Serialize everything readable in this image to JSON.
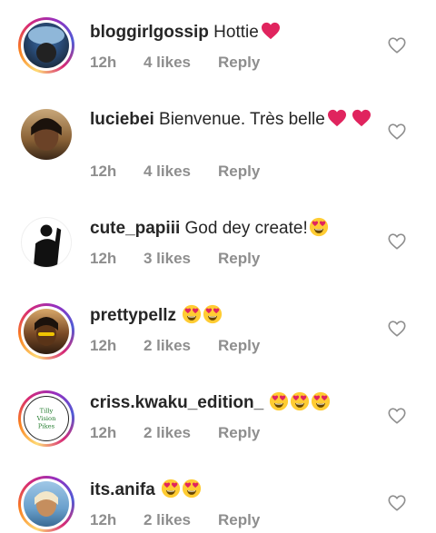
{
  "comments": [
    {
      "username": "bloggirlgossip",
      "text": "Hottie",
      "time": "12h",
      "likes": "4 likes",
      "reply": "Reply"
    },
    {
      "username": "luciebei",
      "text": "Bienvenue. Très belle",
      "time": "12h",
      "likes": "4 likes",
      "reply": "Reply"
    },
    {
      "username": "cute_papiii",
      "text": "God dey create!",
      "time": "12h",
      "likes": "3 likes",
      "reply": "Reply"
    },
    {
      "username": "prettypellz",
      "text": "",
      "time": "12h",
      "likes": "2 likes",
      "reply": "Reply"
    },
    {
      "username": "criss.kwaku_edition_",
      "text": "",
      "time": "12h",
      "likes": "2 likes",
      "reply": "Reply"
    },
    {
      "username": "its.anifa",
      "text": "",
      "time": "12h",
      "likes": "2 likes",
      "reply": "Reply"
    }
  ],
  "avatar_logo_text": "Tilly Vision Pikes",
  "icons": {
    "like": "heart-outline-icon",
    "emoji_heart": "red-heart-emoji",
    "emoji_hearteyes": "heart-eyes-emoji"
  },
  "colors": {
    "text": "#262626",
    "meta": "#8e8e8e",
    "heart_red": "#e0245e",
    "emoji_yellow": "#ffcc33"
  }
}
